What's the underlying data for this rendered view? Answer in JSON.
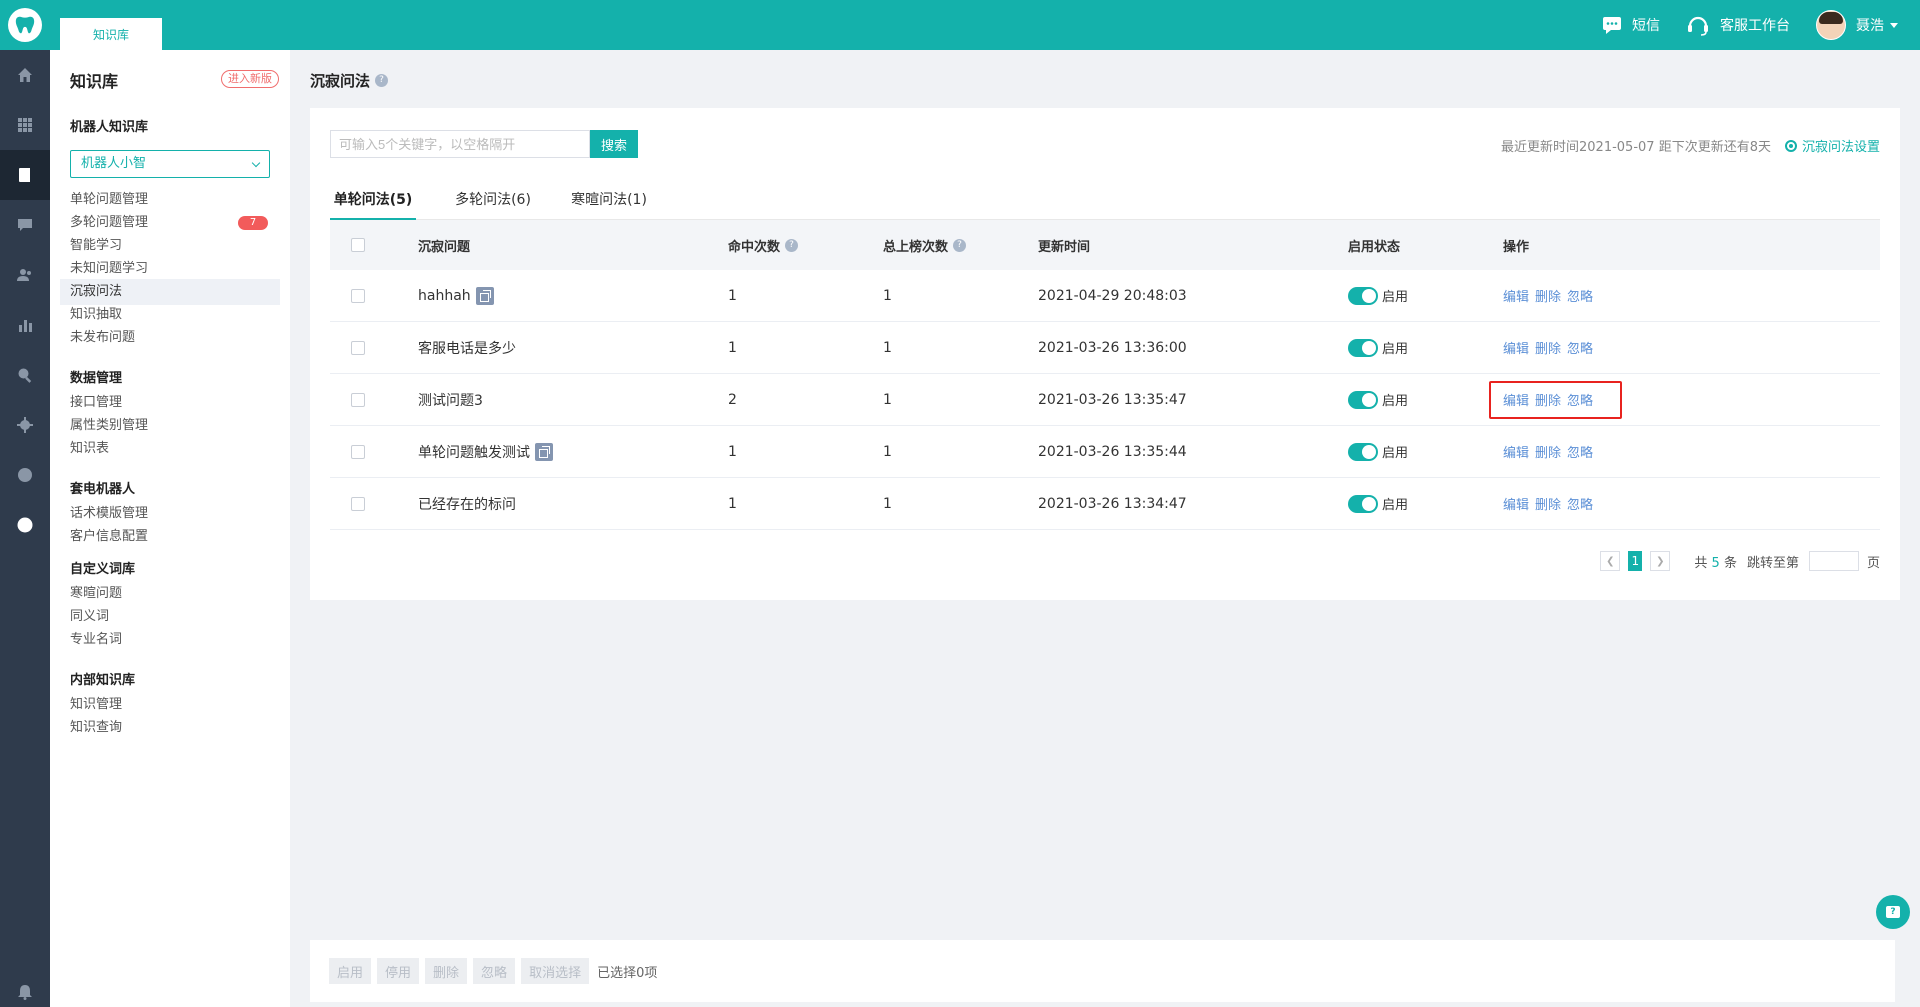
{
  "header": {
    "tab_label": "知识库",
    "sms_label": "短信",
    "workbench_label": "客服工作台",
    "user_name": "聂浩"
  },
  "rail": {
    "icons": [
      "home-icon",
      "apps-icon",
      "book-icon",
      "chat-icon",
      "users-icon",
      "chart-icon",
      "search-doc-icon",
      "settings-icon",
      "robot-icon",
      "account-icon",
      "bell-icon"
    ]
  },
  "sidebar": {
    "title": "知识库",
    "new_version_label": "进入新版",
    "group_robot": "机器人知识库",
    "robot_select": "机器人小智",
    "robot_items": [
      {
        "label": "单轮问题管理"
      },
      {
        "label": "多轮问题管理",
        "badge": "7"
      },
      {
        "label": "智能学习"
      },
      {
        "label": "未知问题学习"
      },
      {
        "label": "沉寂问法"
      },
      {
        "label": "知识抽取"
      },
      {
        "label": "未发布问题"
      }
    ],
    "group_data": "数据管理",
    "data_items": [
      "接口管理",
      "属性类别管理",
      "知识表"
    ],
    "group_call": "套电机器人",
    "call_items": [
      "话术模版管理",
      "客户信息配置"
    ],
    "group_custom": "自定义词库",
    "custom_items": [
      "寒暄问题",
      "同义词",
      "专业名词"
    ],
    "group_internal": "内部知识库",
    "internal_items": [
      "知识管理",
      "知识查询"
    ]
  },
  "main": {
    "title": "沉寂问法",
    "search_placeholder": "可输入5个关键字，以空格隔开",
    "search_button": "搜索",
    "update_info": "最近更新时间2021-05-07 距下次更新还有8天",
    "settings_link": "沉寂问法设置",
    "tabs": [
      "单轮问法(5)",
      "多轮问法(6)",
      "寒暄问法(1)"
    ],
    "columns": {
      "question": "沉寂问题",
      "hits": "命中次数",
      "rank": "总上榜次数",
      "updated": "更新时间",
      "status": "启用状态",
      "ops": "操作"
    },
    "rows": [
      {
        "question": "hahhah",
        "hits": "1",
        "rank": "1",
        "updated": "2021-04-29 20:48:03",
        "status": "启用",
        "copy": true
      },
      {
        "question": "客服电话是多少",
        "hits": "1",
        "rank": "1",
        "updated": "2021-03-26 13:36:00",
        "status": "启用",
        "copy": false
      },
      {
        "question": "测试问题3",
        "hits": "2",
        "rank": "1",
        "updated": "2021-03-26 13:35:47",
        "status": "启用",
        "copy": false
      },
      {
        "question": "单轮问题触发测试",
        "hits": "1",
        "rank": "1",
        "updated": "2021-03-26 13:35:44",
        "status": "启用",
        "copy": true
      },
      {
        "question": "已经存在的标问",
        "hits": "1",
        "rank": "1",
        "updated": "2021-03-26 13:34:47",
        "status": "启用",
        "copy": false
      }
    ],
    "ops": {
      "edit": "编辑",
      "delete": "删除",
      "ignore": "忽略"
    },
    "pager": {
      "current": "1",
      "total_prefix": "共",
      "total": "5",
      "total_suffix": "条",
      "jump_label": "跳转至第",
      "page_suffix": "页"
    }
  },
  "bottom": {
    "buttons": [
      "启用",
      "停用",
      "删除",
      "忽略",
      "取消选择"
    ],
    "selected_text": "已选择0项"
  },
  "colors": {
    "accent": "#14b1ab",
    "rail": "#2f3b4c",
    "link": "#5b8fd6",
    "highlight": "#e8231f"
  }
}
